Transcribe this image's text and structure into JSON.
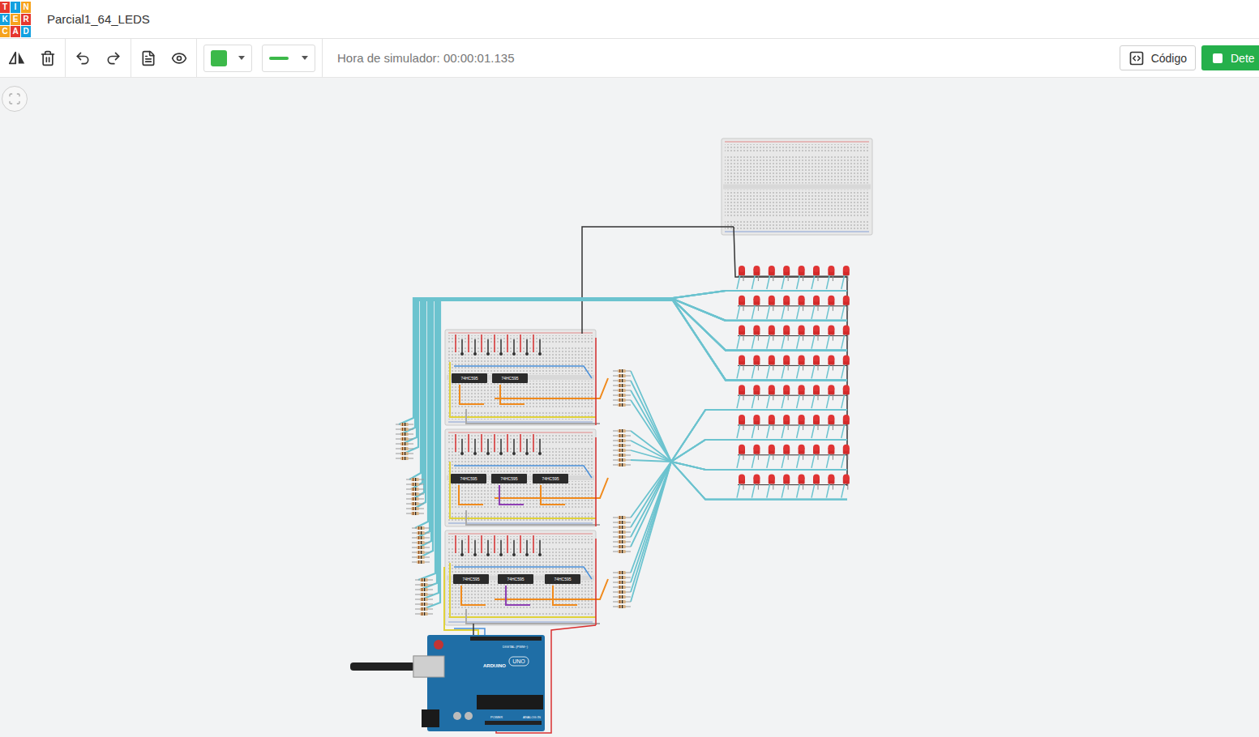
{
  "window": {
    "title": "Parcial1_64_LEDS"
  },
  "logo": [
    {
      "letter": "T",
      "color": "#e5372e"
    },
    {
      "letter": "I",
      "color": "#12a0e0"
    },
    {
      "letter": "N",
      "color": "#f6a21c"
    },
    {
      "letter": "K",
      "color": "#12a0e0"
    },
    {
      "letter": "E",
      "color": "#f6a21c"
    },
    {
      "letter": "R",
      "color": "#e5372e"
    },
    {
      "letter": "C",
      "color": "#f6a21c"
    },
    {
      "letter": "A",
      "color": "#e5372e"
    },
    {
      "letter": "D",
      "color": "#12a0e0"
    }
  ],
  "toolbar": {
    "simulator_time": "Hora de simulador: 00:00:01.135",
    "fill_color": "#3cb94a",
    "code_button": "Código",
    "stop_button": "Dete"
  },
  "circuit": {
    "breadboards": [
      {
        "chips": [
          "74HC595",
          "74HC595"
        ]
      },
      {
        "chips": [
          "74HC595",
          "74HC595",
          "74HC595"
        ]
      },
      {
        "chips": [
          "74HC595",
          "74HC595",
          "74HC595"
        ]
      }
    ],
    "led_matrix": {
      "rows": 8,
      "cols": 8
    },
    "arduino": {
      "brand": "ARDUINO",
      "model": "UNO",
      "labels": [
        "DIGITAL (PWM~)",
        "POWER",
        "ANALOG IN"
      ]
    }
  }
}
